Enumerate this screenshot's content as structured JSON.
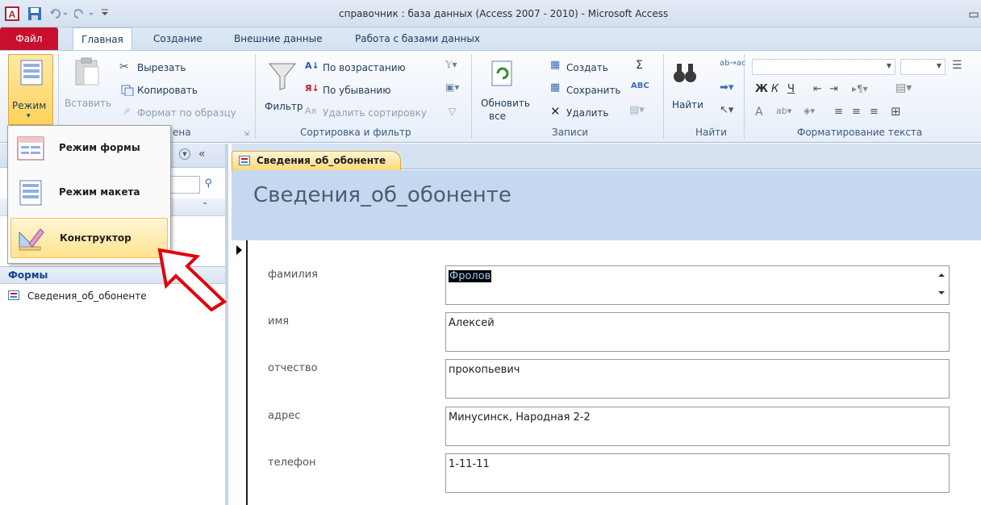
{
  "window": {
    "title": "справочник : база данных (Access 2007 - 2010)  -  Microsoft Access",
    "app_icon": "access-app-icon"
  },
  "ribbon_tabs": [
    {
      "label": "Файл",
      "active": false
    },
    {
      "label": "Главная",
      "active": true
    },
    {
      "label": "Создание",
      "active": false
    },
    {
      "label": "Внешние данные",
      "active": false
    },
    {
      "label": "Работа с базами данных",
      "active": false
    }
  ],
  "ribbon": {
    "view": {
      "label": "Режим",
      "dropdown": "▾"
    },
    "clipboard": {
      "paste_label": "Вставить",
      "cut_label": "Вырезать",
      "copy_label": "Копировать",
      "format_painter_label": "Формат по образцу",
      "group_label": "ена"
    },
    "sort_filter": {
      "filter_label": "Фильтр",
      "ascending_label": "По возрастанию",
      "descending_label": "По убыванию",
      "remove_sort_label": "Удалить сортировку",
      "group_label": "Сортировка и фильтр"
    },
    "records": {
      "refresh_label_1": "Обновить",
      "refresh_label_2": "все",
      "new_label": "Создать",
      "save_label": "Сохранить",
      "delete_label": "Удалить",
      "group_label": "Записи"
    },
    "find": {
      "find_label": "Найти",
      "group_label": "Найти"
    },
    "text_format": {
      "bold": "Ж",
      "italic": "К",
      "underline": "Ч",
      "font_color": "A",
      "group_label": "Форматирование текста"
    }
  },
  "view_menu": {
    "items": [
      {
        "label": "Режим формы",
        "highlighted": false
      },
      {
        "label": "Режим макета",
        "highlighted": false
      },
      {
        "label": "Конструктор",
        "highlighted": true
      }
    ]
  },
  "nav_pane": {
    "collapse": "«",
    "section_label": "Формы",
    "items": [
      "Сведения_об_обоненте"
    ]
  },
  "document": {
    "tab_label": "Сведения_об_обоненте",
    "header_title": "Сведения_об_обоненте"
  },
  "form_fields": [
    {
      "label": "фамилия",
      "value": "Фролов"
    },
    {
      "label": "имя",
      "value": "Алексей"
    },
    {
      "label": "отчество",
      "value": "прокопьевич"
    },
    {
      "label": "адрес",
      "value": "Минусинск, Народная 2-2"
    },
    {
      "label": "телефон",
      "value": "1-11-11"
    }
  ],
  "colors": {
    "file_tab": "#c8102e",
    "highlight": "#ffe38f",
    "arrow": "#e0000f"
  }
}
